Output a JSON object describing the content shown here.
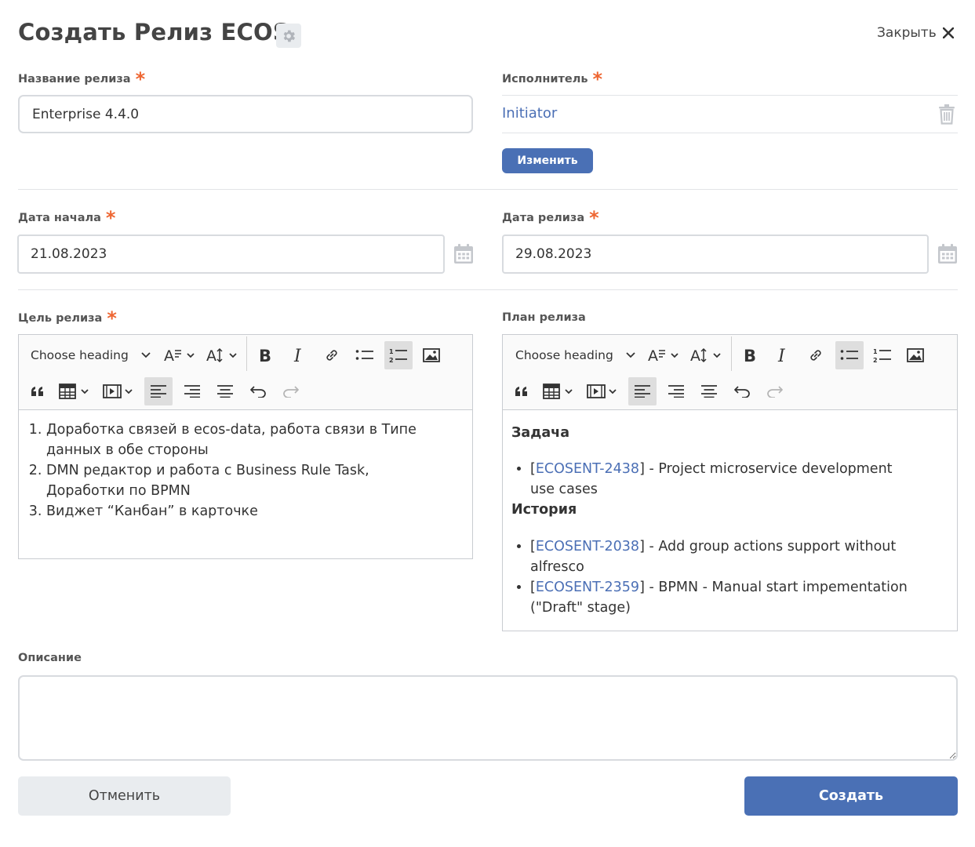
{
  "header": {
    "title": "Создать Релиз ECOS",
    "close_label": "Закрыть"
  },
  "fields": {
    "release_name": {
      "label": "Название релиза",
      "value": "Enterprise 4.4.0"
    },
    "executor": {
      "label": "Исполнитель",
      "value": "Initiator",
      "change_label": "Изменить"
    },
    "start_date": {
      "label": "Дата начала",
      "value": "21.08.2023"
    },
    "release_date": {
      "label": "Дата релиза",
      "value": "29.08.2023"
    },
    "goal": {
      "label": "Цель релиза",
      "items": [
        "Доработка связей в ecos-data, работа связи в Типе данных в обе стороны",
        "DMN редактор и работа с Business Rule Task, Доработки по BPMN",
        "Виджет “Канбан” в карточке"
      ]
    },
    "plan": {
      "label": "План релиза",
      "sections": [
        {
          "heading": "Задача",
          "items": [
            {
              "key": "ECOSENT-2438",
              "text": "] - Project microservice development use cases"
            }
          ]
        },
        {
          "heading": "История",
          "items": [
            {
              "key": "ECOSENT-2038",
              "text": "] - Add group actions support without alfresco"
            },
            {
              "key": "ECOSENT-2359",
              "text": "] - BPMN - Manual start impementation (\"Draft\" stage)"
            }
          ]
        }
      ]
    },
    "description": {
      "label": "Описание",
      "value": ""
    }
  },
  "editor_toolbar": {
    "heading_label": "Choose heading"
  },
  "required_mark": "*",
  "link_bracket": "[",
  "buttons": {
    "cancel": "Отменить",
    "create": "Создать"
  },
  "colors": {
    "accent": "#4a70b5",
    "required": "#ee6632",
    "link": "#4b6fb5"
  }
}
